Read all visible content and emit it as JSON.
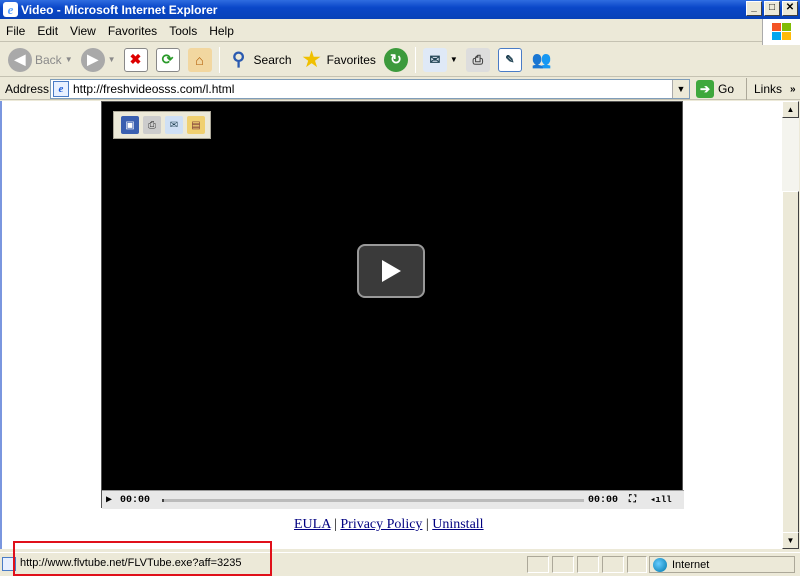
{
  "window": {
    "title": "Video - Microsoft Internet Explorer"
  },
  "menu": [
    "File",
    "Edit",
    "View",
    "Favorites",
    "Tools",
    "Help"
  ],
  "toolbar": {
    "back_label": "Back",
    "search_label": "Search",
    "favorites_label": "Favorites"
  },
  "address": {
    "label": "Address",
    "url": "http://freshvideosss.com/l.html",
    "go_label": "Go",
    "links_label": "Links"
  },
  "player": {
    "time_elapsed": "00:00",
    "time_total": "00:00"
  },
  "footer": {
    "eula": "EULA",
    "privacy": "Privacy Policy",
    "uninstall": "Uninstall",
    "sep": "|"
  },
  "status": {
    "text": "http://www.flvtube.net/FLVTube.exe?aff=3235",
    "zone": "Internet"
  },
  "colors": {
    "highlight": "#e0101a",
    "titlebar": "#0a47c8"
  }
}
